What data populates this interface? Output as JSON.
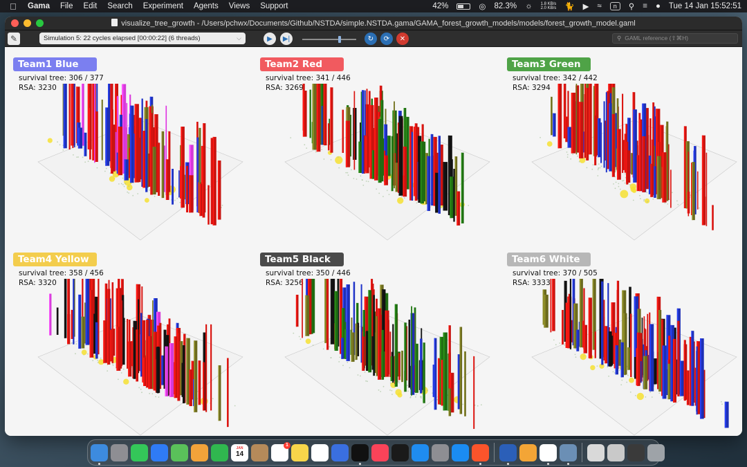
{
  "menubar": {
    "app_name": "Gama",
    "items": [
      "File",
      "Edit",
      "Search",
      "Experiment",
      "Agents",
      "Views",
      "Support"
    ],
    "battery_percent": "42%",
    "cpu_percent": "82.3%",
    "net_up": "1.8 KB/s",
    "net_down": "2.0 KB/s",
    "input_indicator": "n",
    "datetime": "Tue 14 Jan  15:52:51"
  },
  "window": {
    "title": "visualize_tree_growth - /Users/pchwx/Documents/Github/NSTDA/simple.NSTDA.gama/GAMA_forest_growth_models/models/forest_growth_model.gaml"
  },
  "toolbar": {
    "simulation_status": "Simulation 5: 22 cycles elapsed [00:00:22] (6 threads)",
    "search_placeholder": "GAML reference (⇧⌘H)"
  },
  "panels": [
    {
      "team": "Team1 Blue",
      "label_color": "#7b7ff0",
      "survival": "survival tree: 306 / 377",
      "rsa": "RSA: 3230"
    },
    {
      "team": "Team2 Red",
      "label_color": "#f15a5f",
      "survival": "survival tree: 341 / 446",
      "rsa": "RSA: 3269"
    },
    {
      "team": "Team3 Green",
      "label_color": "#4fa347",
      "survival": "survival tree: 342 / 442",
      "rsa": "RSA: 3294"
    },
    {
      "team": "Team4 Yellow",
      "label_color": "#f3cd4d",
      "survival": "survival tree: 358 / 456",
      "rsa": "RSA: 3320"
    },
    {
      "team": "Team5 Black",
      "label_color": "#4a4a4a",
      "survival": "survival tree: 350 / 446",
      "rsa": "RSA: 3256"
    },
    {
      "team": "Team6 White",
      "label_color": "#b7b7b7",
      "survival": "survival tree: 370 / 505",
      "rsa": "RSA: 3333"
    }
  ],
  "colors": {
    "tree_red": "#c8130f",
    "tree_blue": "#1d2fb5",
    "tree_green": "#1f6b12",
    "tree_olive": "#6b6a1e",
    "tree_black": "#111111",
    "tree_magenta": "#d43ad8",
    "tree_yellow": "#f6e032",
    "ground_grid": "#c9c9c9"
  },
  "dock": {
    "calendar_day": "14",
    "calendar_month": "JAN",
    "reminders_badge": "1",
    "apps": [
      "finder-icon",
      "launchpad-icon",
      "messages-icon",
      "mail-icon",
      "maps-icon",
      "photos-icon",
      "facetime-icon",
      "calendar-icon",
      "contacts-icon",
      "reminders-icon",
      "notes-icon",
      "freeform-icon",
      "mirroring-icon",
      "appletv-icon",
      "music-icon",
      "webex-icon",
      "appstore-icon",
      "settings-icon",
      "safari-icon",
      "brave-icon",
      "word-icon",
      "pages-icon",
      "chrome-icon",
      "preview-icon",
      "docs-icon",
      "stack-icon",
      "keyboard-icon",
      "trash-icon"
    ]
  }
}
